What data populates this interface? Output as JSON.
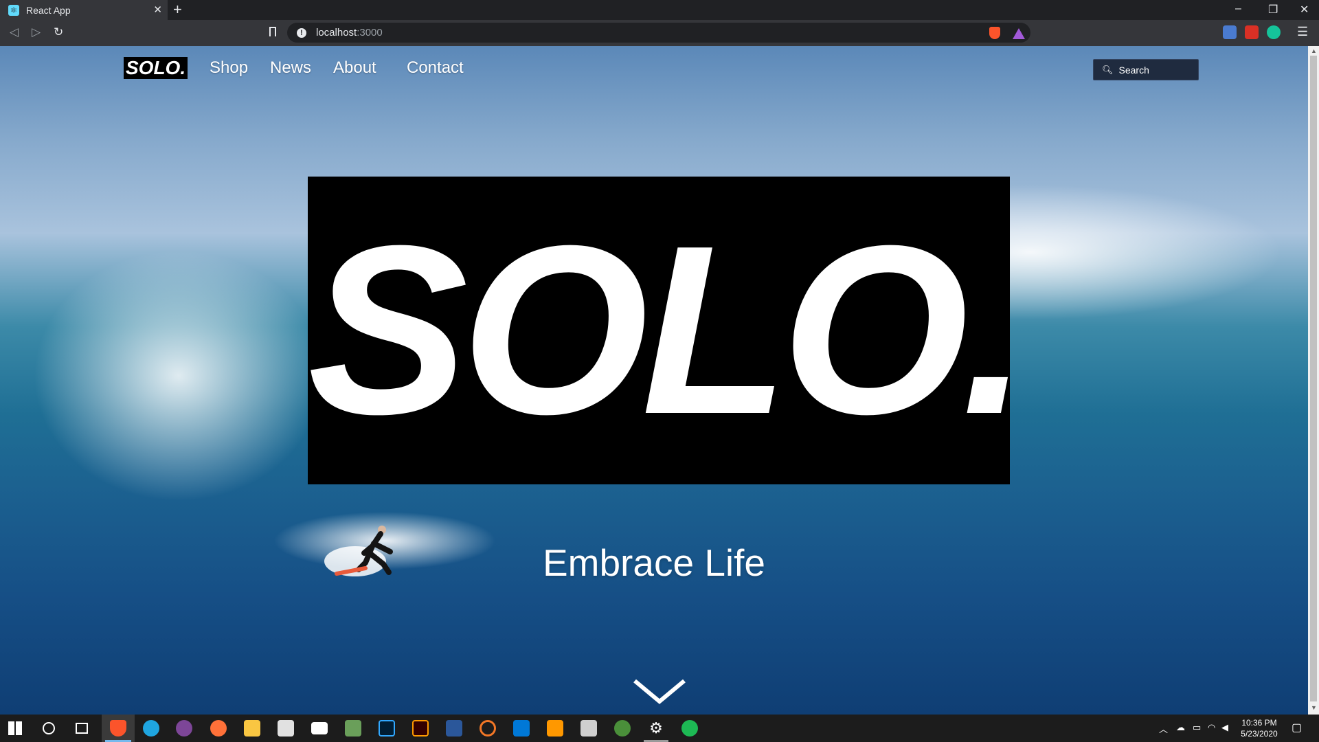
{
  "browser": {
    "tab_title": "React App",
    "tab_close": "✕",
    "new_tab": "+",
    "url_host": "localhost",
    "url_port": ":3000",
    "window_controls": {
      "minimize": "–",
      "restore": "❐",
      "close": "✕"
    }
  },
  "site": {
    "brand": "SOLO.",
    "nav": [
      "Shop",
      "News",
      "About",
      "Contact"
    ],
    "search_placeholder": "Search",
    "hero_title": "SOLO.",
    "tagline": "Embrace Life"
  },
  "taskbar": {
    "time": "10:36 PM",
    "date": "5/23/2020",
    "apps": [
      "windows-start-icon",
      "cortana-icon",
      "task-view-icon",
      "brave-icon",
      "edge-icon",
      "tor-icon",
      "firefox-icon",
      "file-explorer-icon",
      "store-icon",
      "mail-icon",
      "xampp-icon",
      "photoshop-icon",
      "illustrator-icon",
      "word-icon",
      "jupyter-icon",
      "vscode-icon",
      "sublime-icon",
      "mpk-mini-icon",
      "game-icon",
      "settings-icon",
      "spotify-icon"
    ]
  },
  "colors": {
    "accent": "#76b9ed",
    "hero_box": "#000000",
    "search_bg": "#1f2b3f"
  }
}
